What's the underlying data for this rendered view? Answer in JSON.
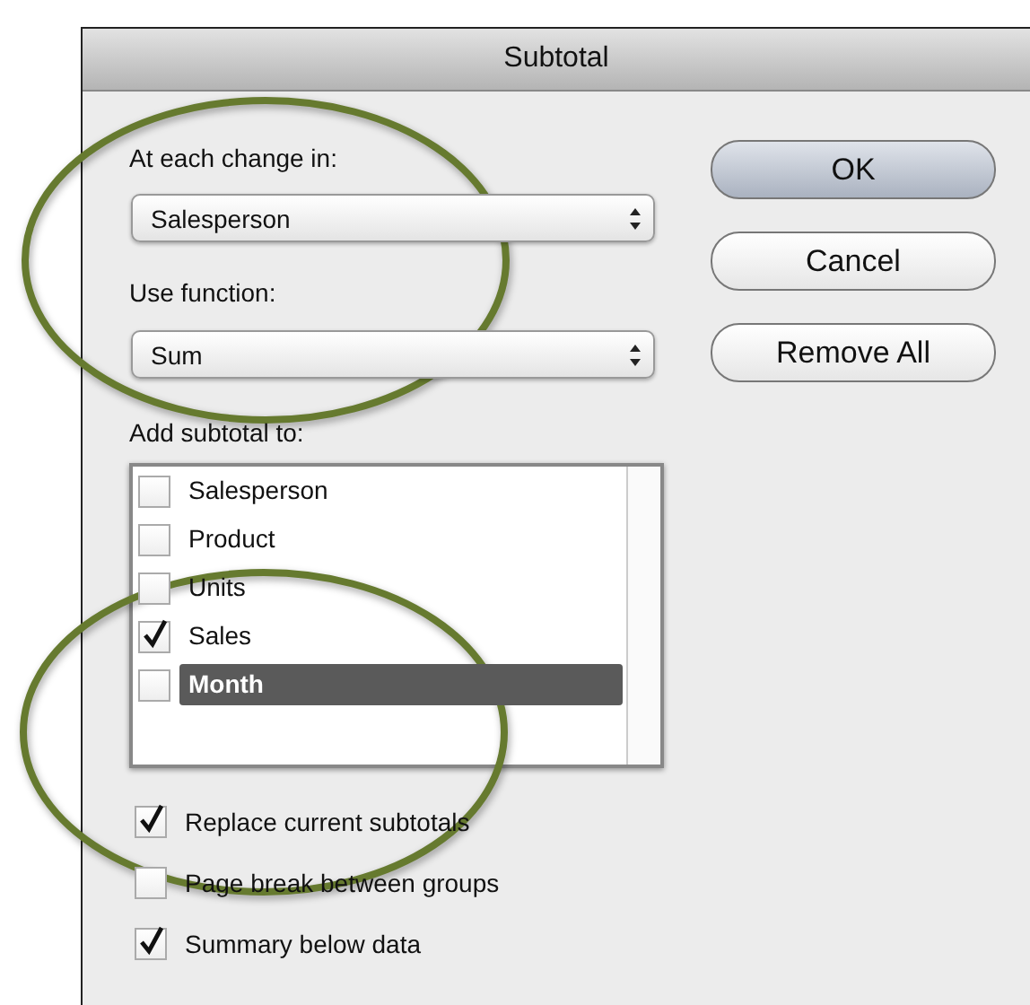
{
  "window": {
    "title": "Subtotal"
  },
  "popups": [
    {
      "label": "At each change in:",
      "value": "Salesperson"
    },
    {
      "label": "Use function:",
      "value": "Sum"
    }
  ],
  "buttons": [
    {
      "label": "OK",
      "default": true
    },
    {
      "label": "Cancel",
      "default": false
    },
    {
      "label": "Remove All",
      "default": false
    }
  ],
  "list": {
    "label": "Add subtotal to:",
    "items": [
      {
        "label": "Salesperson",
        "checked": false,
        "selected": false
      },
      {
        "label": "Product",
        "checked": false,
        "selected": false
      },
      {
        "label": "Units",
        "checked": false,
        "selected": false
      },
      {
        "label": "Sales",
        "checked": true,
        "selected": false
      },
      {
        "label": "Month",
        "checked": false,
        "selected": true
      }
    ]
  },
  "options": [
    {
      "label": "Replace current subtotals",
      "checked": true
    },
    {
      "label": "Page break between groups",
      "checked": false
    },
    {
      "label": "Summary below data",
      "checked": true
    }
  ],
  "annotations": [
    {
      "kind": "ellipse"
    },
    {
      "kind": "ellipse"
    }
  ]
}
